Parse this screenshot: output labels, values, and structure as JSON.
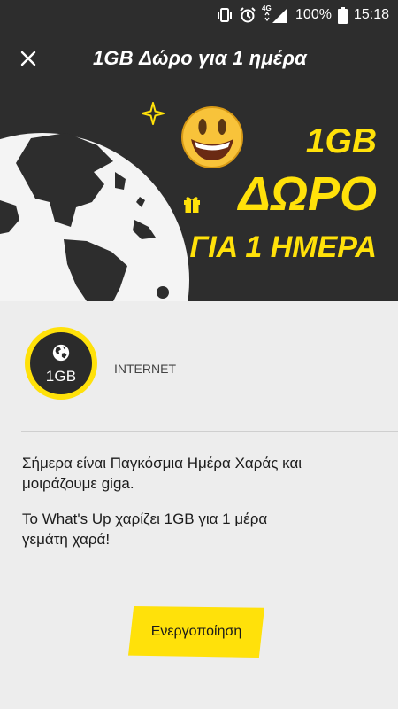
{
  "status_bar": {
    "network": "4G",
    "battery": "100%",
    "time": "15:18",
    "icons": [
      "vibrate-icon",
      "alarm-icon",
      "signal-icon",
      "battery-icon"
    ]
  },
  "app_bar": {
    "title": "1GB Δώρο για 1 ημέρα",
    "close_icon": "close-icon"
  },
  "hero": {
    "line1": "1GB",
    "line2": "ΔΩΡΟ",
    "line3": "ΓΙΑ 1 ΗΜΕΡΑ",
    "accent_color": "#ffe10a",
    "icons": [
      "globe-illustration",
      "smiley-emoji-icon",
      "sparkle-icon",
      "gift-icon"
    ]
  },
  "offer": {
    "amount": "1GB",
    "service": "INTERNET",
    "icon": "globe-icon"
  },
  "description": {
    "paragraph1": "Σήμερα είναι Παγκόσμια Ημέρα Χαράς και μοιράζουμε giga.",
    "paragraph2": "Το What's Up χαρίζει 1GB για 1 μέρα γεμάτη χαρά!"
  },
  "actions": {
    "activate_label": "Ενεργοποίηση"
  },
  "colors": {
    "dark": "#2d2d2d",
    "accent": "#ffe10a",
    "background": "#ededed"
  }
}
